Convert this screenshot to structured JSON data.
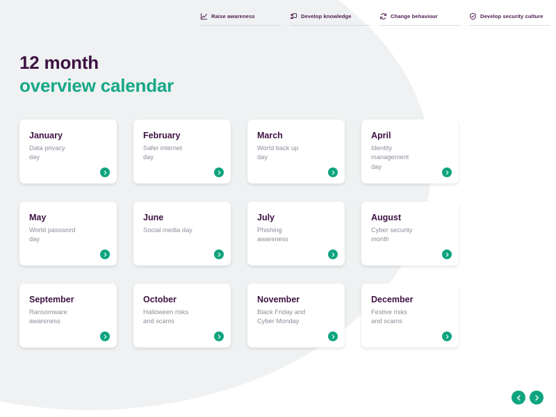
{
  "nav": {
    "items": [
      {
        "label": "Raise awareness",
        "icon": "chart-trend-icon"
      },
      {
        "label": "Develop knowledge",
        "icon": "presentation-person-icon"
      },
      {
        "label": "Change behaviour",
        "icon": "refresh-cycle-icon"
      },
      {
        "label": "Develop security culture",
        "icon": "shield-check-icon"
      }
    ]
  },
  "heading": {
    "line1": "12 month",
    "line2": "overview calendar"
  },
  "months": [
    {
      "name": "January",
      "desc": "Data privacy\nday"
    },
    {
      "name": "February",
      "desc": "Safer internet\nday"
    },
    {
      "name": "March",
      "desc": "World back up\nday"
    },
    {
      "name": "April",
      "desc": "Identity\nmanagement\nday"
    },
    {
      "name": "May",
      "desc": "World password\nday"
    },
    {
      "name": "June",
      "desc": "Social media day"
    },
    {
      "name": "July",
      "desc": "Phishing\nawareness"
    },
    {
      "name": "August",
      "desc": "Cyber security\nmonth"
    },
    {
      "name": "September",
      "desc": "Ransomware\nawareness"
    },
    {
      "name": "October",
      "desc": "Halloween risks\nand scams"
    },
    {
      "name": "November",
      "desc": "Black Friday and\nCyber Monday"
    },
    {
      "name": "December",
      "desc": "Festive risks\nand scams"
    }
  ],
  "pager": {
    "prev_icon": "chevron-left-icon",
    "next_icon": "chevron-right-icon"
  },
  "colors": {
    "accent_teal": "#0fa47f",
    "heading_teal": "#16a887",
    "purple": "#3d1242",
    "muted_text": "#8c8f9a",
    "blob_gray": "#eff1f2"
  }
}
